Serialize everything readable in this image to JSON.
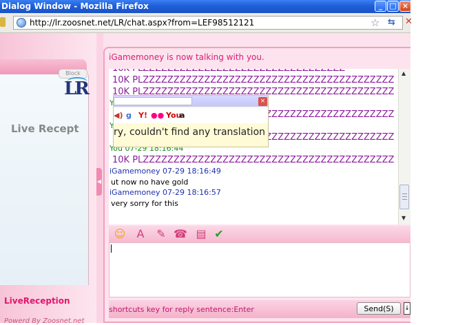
{
  "window": {
    "title": "Dialog Window - Mozilla Firefox",
    "controls": {
      "minimize": "_",
      "maximize": "□",
      "close": "×"
    }
  },
  "addressbar": {
    "url": "http://lr.zoosnet.net/LR/chat.aspx?from=LEF98512121",
    "site_icon": "globe-icon",
    "bookmark_icon": "star-icon",
    "go_icon": "go-arrow-icon",
    "stop_icon": "stop-icon"
  },
  "sidebar": {
    "block_label": "Block",
    "logo_text": "LR",
    "title": "Live Recept",
    "footer_label": "LiveReception",
    "powered_by": "Powerd By Zoosnet.net"
  },
  "chat": {
    "status": "iGamemoney is now talking with you.",
    "messages": [
      {
        "sender": "",
        "time": "",
        "text": "10K PLZZZZZZZZZZZZZZZZZZZZZZZZZZZZZZZZZ",
        "kind": "you"
      },
      {
        "sender": "You",
        "time": "07-29 18:16:42",
        "text": "10K PLZZZZZZZZZZZZZZZZZZZZZZZZZZZZZZZZZZZZZZZZZ",
        "kind": "you"
      },
      {
        "sender": "You",
        "time": "07-29 18:16:43",
        "text": "10K PLZZZZZZZZZZZZZZZZZZZZZZZZZZZZZZZZZZZZZZZZZ",
        "kind": "you"
      },
      {
        "sender": "You",
        "time": "07-29 18:16:44",
        "text": "10K PLZZZZZZZZZZZZZZZZZZZZZZZZZZZZZZZZZZZZZZZZZ",
        "kind": "you"
      },
      {
        "sender": "iGamemoney",
        "time": "07-29 18:16:49",
        "text": "ut now no have gold",
        "kind": "peer"
      },
      {
        "sender": "iGamemoney",
        "time": "07-29 18:16:57",
        "text": "very sorry for this",
        "kind": "peer"
      }
    ],
    "hidden_lines": [
      "10K PLZZZZZZZZZZZZZZZZZZZZZZZZZZZZZZZZZZZZZZZZZ",
      "10K PLZZZZZZZZZZZZZZZZZZZZZZZZZZZZZZZZZZZZZZZZZ"
    ]
  },
  "translate_popup": {
    "message": "ry, couldn't find any translation",
    "close": "×",
    "services": [
      "speaker-icon",
      "google-icon",
      "yahoo-icon",
      "flickr-icon",
      "youtube-icon",
      "amazon-icon"
    ],
    "service_glyphs": [
      "◀)",
      "g",
      "Y!",
      "●●",
      "You",
      "a"
    ],
    "service_colors": [
      "#c0392b",
      "#3b6fd6",
      "#d01010",
      "#ff0084",
      "#c00",
      "#111"
    ]
  },
  "toolbar": {
    "tools": [
      "emoticon-icon",
      "font-icon",
      "edit-icon",
      "phone-icon",
      "clipboard-icon",
      "check-icon"
    ],
    "glyphs": [
      "☺",
      "A",
      "✎",
      "☎",
      "▤",
      "✔"
    ],
    "colors": [
      "#e8a317",
      "#d23c7a",
      "#d23c7a",
      "#d23c7a",
      "#d23c7a",
      "#2a9d2a"
    ]
  },
  "footer": {
    "hint": "shortcuts key for reply sentence:Enter",
    "send_label": "Send(S)",
    "send_dropdown": "↓"
  }
}
